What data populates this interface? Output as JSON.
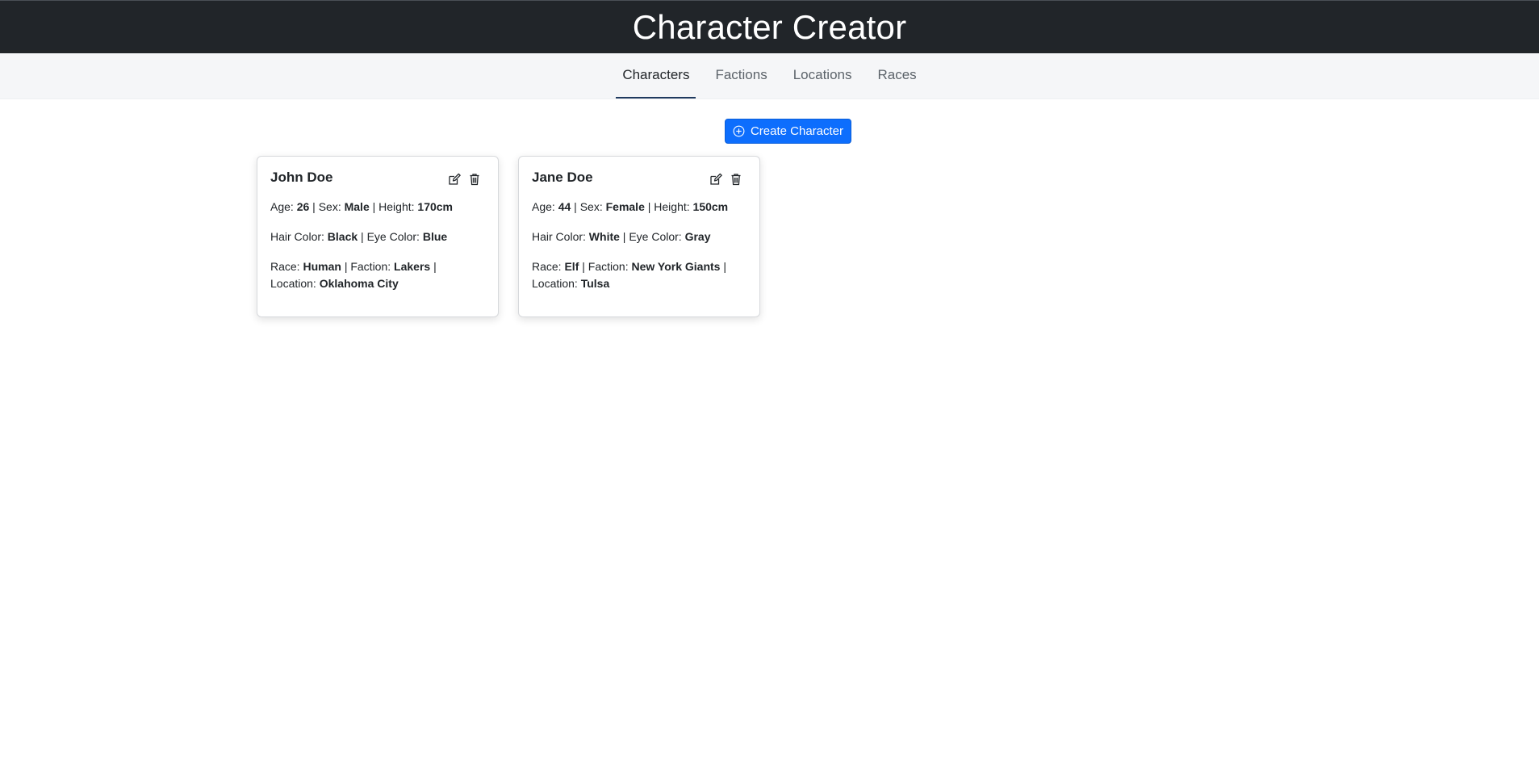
{
  "header": {
    "title": "Character Creator"
  },
  "nav": {
    "tabs": [
      {
        "label": "Characters",
        "active": true
      },
      {
        "label": "Factions",
        "active": false
      },
      {
        "label": "Locations",
        "active": false
      },
      {
        "label": "Races",
        "active": false
      }
    ]
  },
  "toolbar": {
    "create_label": "Create Character",
    "create_icon": "plus-circle-icon"
  },
  "labels": {
    "age": "Age:",
    "sex": "Sex:",
    "height": "Height:",
    "hair": "Hair Color:",
    "eye": "Eye Color:",
    "race": "Race:",
    "faction": "Faction:",
    "location": "Location:",
    "sep": "|"
  },
  "characters": [
    {
      "name": "John Doe",
      "age": "26",
      "sex": "Male",
      "height": "170cm",
      "hair": "Black",
      "eye": "Blue",
      "race": "Human",
      "faction": "Lakers",
      "location": "Oklahoma City"
    },
    {
      "name": "Jane Doe",
      "age": "44",
      "sex": "Female",
      "height": "150cm",
      "hair": "White",
      "eye": "Gray",
      "race": "Elf",
      "faction": "New York Giants",
      "location": "Tulsa"
    }
  ],
  "colors": {
    "header_bg": "#212529",
    "primary": "#0d6efd",
    "nav_bg": "#f5f6f8",
    "active_underline": "#1f3a5f"
  }
}
